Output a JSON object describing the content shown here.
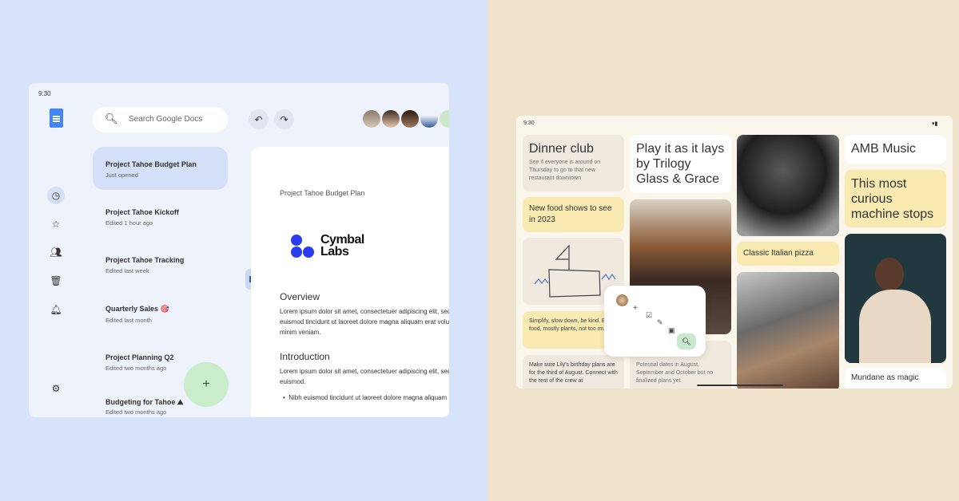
{
  "docs": {
    "time": "9:30",
    "search_placeholder": "Search Google Docs",
    "nav": [
      "recent-clock-icon",
      "star-icon",
      "shared-people-icon",
      "trash-icon",
      "bell-icon",
      "settings-gear-icon"
    ],
    "files": [
      {
        "title": "Project Tahoe Budget Plan",
        "subtitle": "Just opened"
      },
      {
        "title": "Project Tahoe Kickoff",
        "subtitle": "Edited 1 hour ago"
      },
      {
        "title": "Project Tahoe Tracking",
        "subtitle": "Edited last week"
      },
      {
        "title": "Quarterly Sales 🎯",
        "subtitle": "Edited last month"
      },
      {
        "title": "Project Planning Q2",
        "subtitle": "Edited two months ago"
      },
      {
        "title": "Budgeting for Tahoe ⛰",
        "subtitle": "Edited two months ago"
      }
    ],
    "fab": "+",
    "document": {
      "title": "Project Tahoe Budget Plan",
      "logo": "Cymbal Labs",
      "h1": "Overview",
      "p1": [
        "Lorem ipsum dolor sit amet, consectetuer adipiscing elit, sed",
        "euismod tincidunt ut laoreet dolore magna aliquam erat volut",
        "minim veniam."
      ],
      "h2": "Introduction",
      "p2": [
        "Lorem ipsum dolor sit amet, consectetuer adipiscing elit, sed",
        "euismod."
      ],
      "bullet": "Nibh euismod tincidunt ut laoreet dolore magna aliquam"
    },
    "colors": {
      "accent": "#4285f4",
      "selected": "#d3e0f7",
      "fab": "#c9ecca"
    }
  },
  "keep": {
    "time": "9:30",
    "notes": {
      "dinner_title": "Dinner club",
      "dinner_body": "See if everyone is around on Thursday to go to that new restaurant downtown",
      "food": "New food shows to see in 2023",
      "simplify": "Simplify, slow down, be kind. Eat food, mostly plants, not too much",
      "lily": "Make sure Lily's birthday plans are for the third of August. Connect with the rest of the crew at",
      "play": "Play it as it lays by Trilogy Glass & Grace",
      "dates": "Potential dates in August, September and October but no finalized plans yet",
      "pizza": "Classic Italian pizza",
      "amb": "AMB Music",
      "curious": "This most curious machine stops",
      "mundane": "Mundane as magic"
    },
    "colors": {
      "yellow": "#f8eab0",
      "beige": "#efe9df"
    }
  }
}
